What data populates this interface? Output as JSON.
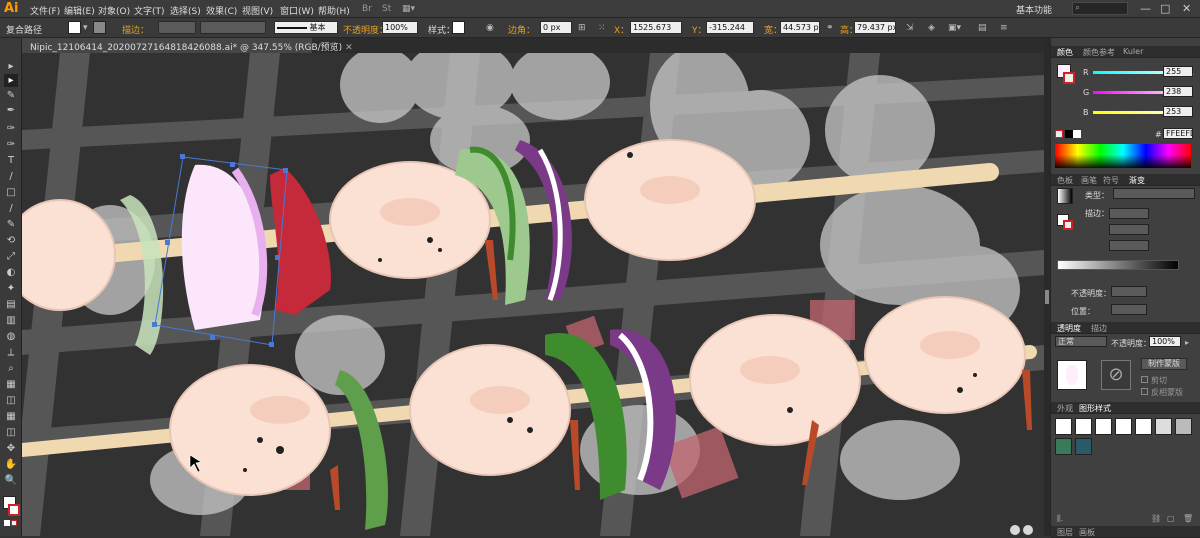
{
  "app": {
    "logo": "Ai",
    "workspace": "基本功能",
    "win_min": "—",
    "win_max": "□",
    "win_close": "✕"
  },
  "menu": [
    "文件(F)",
    "编辑(E)",
    "对象(O)",
    "文字(T)",
    "选择(S)",
    "效果(C)",
    "视图(V)",
    "窗口(W)",
    "帮助(H)"
  ],
  "control": {
    "selection": "复合路径",
    "stroke_label": "描边：",
    "stroke_style": "基本",
    "opacity_label": "不透明度：",
    "opacity_value": "100%",
    "style_label": "样式：",
    "corner_label": "边角：",
    "corner_value": "0 px",
    "x_label": "X：",
    "x_value": "1525.673",
    "y_label": "Y：",
    "y_value": "-315.244",
    "w_label": "宽：",
    "w_value": "44.573 px",
    "h_label": "高：",
    "h_value": "79.437 px"
  },
  "document": {
    "tab": "Nipic_12106414_20200727164818426088.ai* @ 347.55% (RGB/预览)",
    "close": "✕"
  },
  "tools": [
    "▸",
    "▸",
    "✎",
    "✒",
    "✑",
    "T",
    "/",
    "□",
    "/",
    "✎",
    "⟲",
    "⤢",
    "◐",
    "✦",
    "▤",
    "▥",
    "◍",
    "⟂",
    "⌕",
    "▦",
    "◫",
    "✥",
    "✋",
    "🔍"
  ],
  "color_panel": {
    "tabs": [
      "颜色",
      "颜色参考",
      "Kuler"
    ],
    "r_label": "R",
    "r_value": "255",
    "g_label": "G",
    "g_value": "238",
    "b_label": "B",
    "b_value": "253",
    "hex_label": "#",
    "hex_value": "FFEEFD",
    "fill": "#FFEEFD"
  },
  "gradient_panel": {
    "tabs": [
      "色板",
      "画笔",
      "符号",
      "渐变"
    ],
    "type_label": "类型：",
    "stroke_label": "描边：",
    "opacity_label": "不透明度：",
    "position_label": "位置："
  },
  "transparency_panel": {
    "tabs": [
      "透明度",
      "描边"
    ],
    "mode": "正常",
    "opacity_label": "不透明度：",
    "opacity_value": "100%",
    "make_mask": "制作蒙版",
    "clip": "剪切",
    "invert": "反相蒙版"
  },
  "style_panel": {
    "tabs": [
      "外观",
      "图形样式"
    ],
    "bottom_tabs": [
      "图层",
      "画板"
    ]
  }
}
